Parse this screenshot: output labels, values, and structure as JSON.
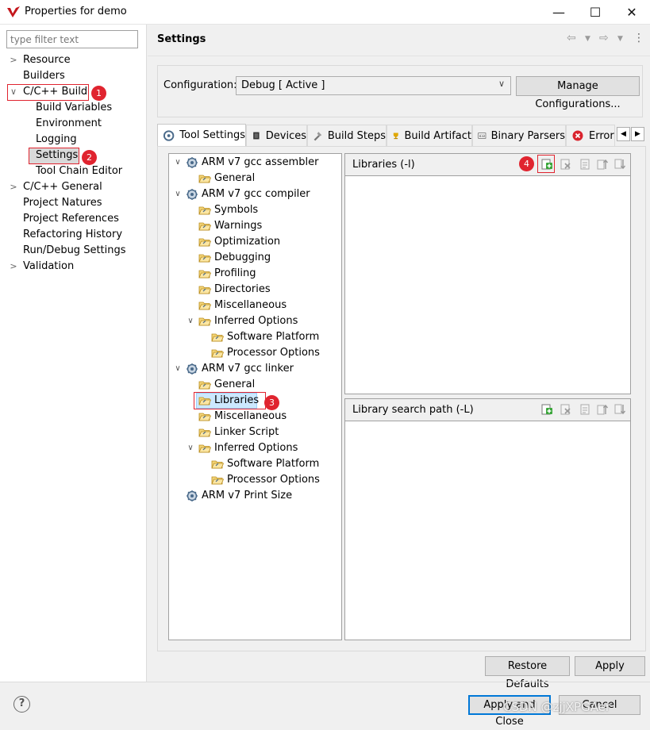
{
  "window": {
    "title": "Properties for demo",
    "min_glyph": "—",
    "max_glyph": "☐",
    "close_glyph": "✕"
  },
  "filter": {
    "placeholder": "type filter text"
  },
  "nav": {
    "items": [
      {
        "label": "Resource"
      },
      {
        "label": "Builders"
      },
      {
        "label": "C/C++ Build"
      },
      {
        "label": "Build Variables"
      },
      {
        "label": "Environment"
      },
      {
        "label": "Logging"
      },
      {
        "label": "Settings"
      },
      {
        "label": "Tool Chain Editor"
      },
      {
        "label": "C/C++ General"
      },
      {
        "label": "Project Natures"
      },
      {
        "label": "Project References"
      },
      {
        "label": "Refactoring History"
      },
      {
        "label": "Run/Debug Settings"
      },
      {
        "label": "Validation"
      }
    ]
  },
  "annotations": [
    "1",
    "2",
    "3",
    "4"
  ],
  "header": {
    "title": "Settings"
  },
  "config": {
    "label": "Configuration:",
    "value": "Debug  [ Active ]",
    "manage_label": "Manage Configurations..."
  },
  "tabs": [
    {
      "label": "Tool Settings",
      "icon": "tool-settings-icon"
    },
    {
      "label": "Devices",
      "icon": "devices-icon"
    },
    {
      "label": "Build Steps",
      "icon": "build-steps-icon"
    },
    {
      "label": "Build Artifact",
      "icon": "build-artifact-icon"
    },
    {
      "label": "Binary Parsers",
      "icon": "binary-parsers-icon"
    },
    {
      "label": "Error",
      "icon": "error-parsers-icon"
    }
  ],
  "tool_tree": [
    {
      "label": "ARM v7 gcc assembler"
    },
    {
      "label": "General"
    },
    {
      "label": "ARM v7 gcc compiler"
    },
    {
      "label": "Symbols"
    },
    {
      "label": "Warnings"
    },
    {
      "label": "Optimization"
    },
    {
      "label": "Debugging"
    },
    {
      "label": "Profiling"
    },
    {
      "label": "Directories"
    },
    {
      "label": "Miscellaneous"
    },
    {
      "label": "Inferred Options"
    },
    {
      "label": "Software Platform"
    },
    {
      "label": "Processor Options"
    },
    {
      "label": "ARM v7 gcc linker"
    },
    {
      "label": "General"
    },
    {
      "label": "Libraries"
    },
    {
      "label": "Miscellaneous"
    },
    {
      "label": "Linker Script"
    },
    {
      "label": "Inferred Options"
    },
    {
      "label": "Software Platform"
    },
    {
      "label": "Processor Options"
    },
    {
      "label": "ARM v7 Print Size"
    }
  ],
  "panels": {
    "libraries_title": "Libraries (-l)",
    "search_path_title": "Library search path (-L)"
  },
  "buttons": {
    "restore_defaults": "Restore Defaults",
    "apply": "Apply",
    "apply_and_close": "Apply and Close",
    "cancel": "Cancel"
  },
  "help_glyph": "?",
  "watermark": "CSDN @zjjXPGAer",
  "colors": {
    "highlight_red": "#e0242f",
    "selection_blue": "#cce8ff"
  }
}
